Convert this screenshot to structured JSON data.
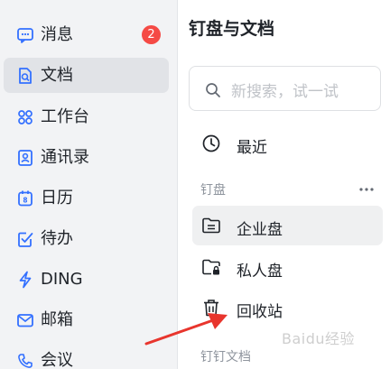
{
  "sidebar": {
    "items": [
      {
        "label": "消息",
        "icon": "chat-icon",
        "badge": "2"
      },
      {
        "label": "文档",
        "icon": "document-icon",
        "active": true
      },
      {
        "label": "工作台",
        "icon": "apps-grid-icon"
      },
      {
        "label": "通讯录",
        "icon": "contacts-icon"
      },
      {
        "label": "日历",
        "icon": "calendar-icon"
      },
      {
        "label": "待办",
        "icon": "todo-check-icon"
      },
      {
        "label": "DING",
        "icon": "lightning-icon"
      },
      {
        "label": "邮箱",
        "icon": "mail-icon"
      },
      {
        "label": "会议",
        "icon": "meeting-phone-icon"
      }
    ]
  },
  "panel": {
    "title": "钉盘与文档",
    "search_placeholder": "新搜索，试一试",
    "recent_label": "最近",
    "section_dingpan": "钉盘",
    "items": [
      {
        "label": "企业盘",
        "icon": "enterprise-folder-icon",
        "active": true
      },
      {
        "label": "私人盘",
        "icon": "private-folder-icon"
      },
      {
        "label": "回收站",
        "icon": "trash-icon"
      }
    ],
    "section_docs": "钉钉文档"
  },
  "watermark": "Baidu经验",
  "colors": {
    "accent": "#3370ff",
    "badge": "#f54a45",
    "arrow": "#e8352d"
  }
}
